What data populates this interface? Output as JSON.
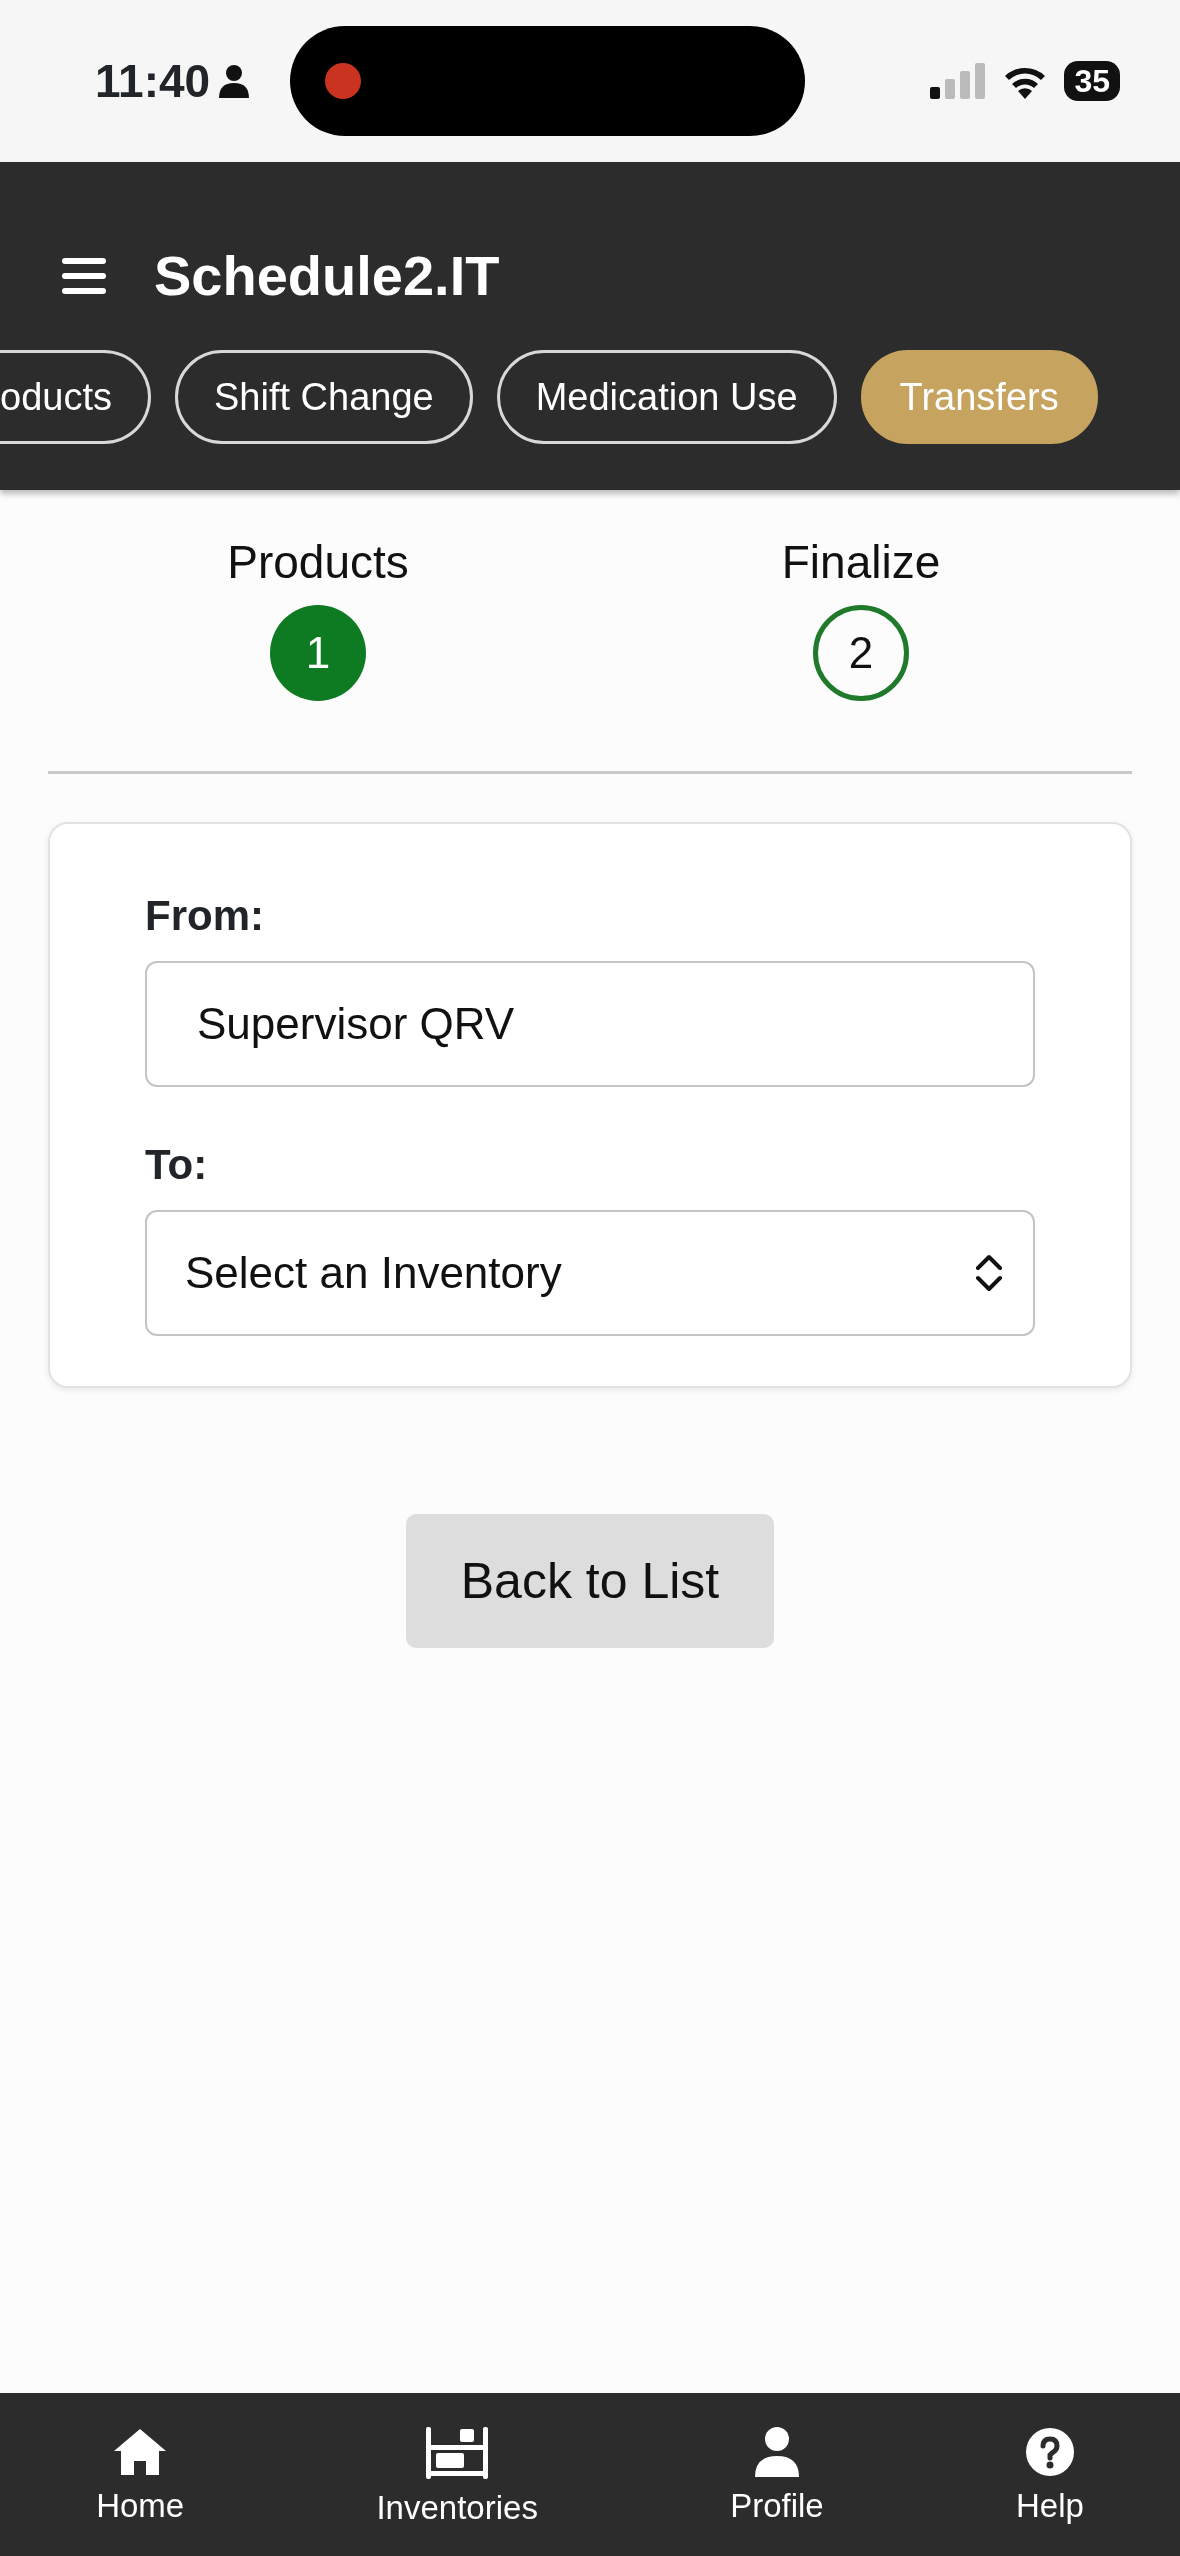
{
  "status_bar": {
    "time": "11:40",
    "battery": "35"
  },
  "header": {
    "title": "Schedule2.IT",
    "tabs": [
      {
        "label": "oducts",
        "selected": false
      },
      {
        "label": "Shift Change",
        "selected": false
      },
      {
        "label": "Medication Use",
        "selected": false
      },
      {
        "label": "Transfers",
        "selected": true
      }
    ]
  },
  "steps": [
    {
      "label": "Products",
      "number": "1",
      "done": true
    },
    {
      "label": "Finalize",
      "number": "2",
      "done": false
    }
  ],
  "form": {
    "from_label": "From:",
    "from_value": "Supervisor QRV",
    "to_label": "To:",
    "to_placeholder": "Select an Inventory"
  },
  "back_button": "Back to List",
  "bottom_nav": [
    {
      "kind": "home",
      "label": "Home"
    },
    {
      "kind": "shelf",
      "label": "Inventories"
    },
    {
      "kind": "person",
      "label": "Profile"
    },
    {
      "kind": "help",
      "label": "Help"
    }
  ]
}
